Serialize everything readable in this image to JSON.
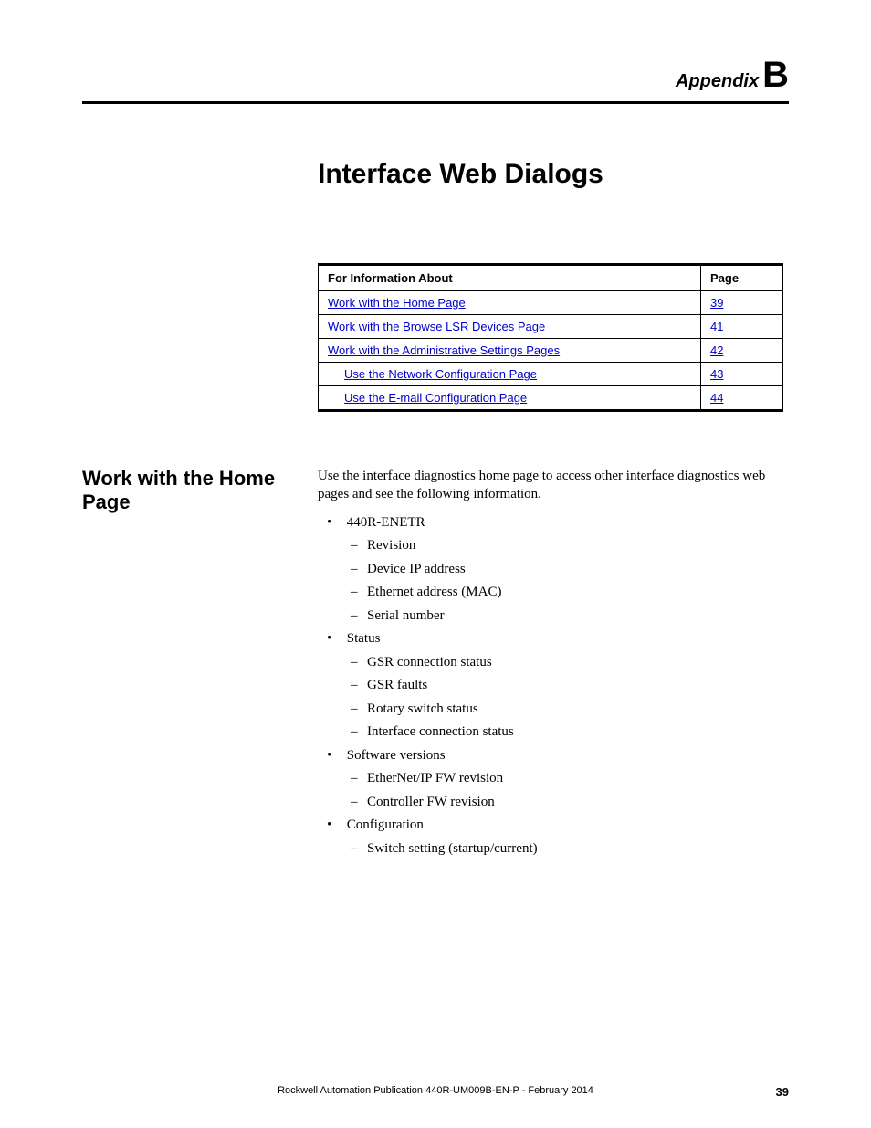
{
  "header": {
    "appendix_word": "Appendix",
    "appendix_letter": "B"
  },
  "chapter_title": "Interface Web Dialogs",
  "toc": {
    "col_info": "For Information About",
    "col_page": "Page",
    "rows": [
      {
        "label": "Work with the Home Page",
        "page": "39",
        "indent": 0
      },
      {
        "label": "Work with the Browse LSR Devices Page",
        "page": "41",
        "indent": 0
      },
      {
        "label": "Work with the Administrative Settings Pages",
        "page": "42",
        "indent": 0
      },
      {
        "label": "Use the Network Configuration Page",
        "page": "43",
        "indent": 1
      },
      {
        "label": "Use the E-mail Configuration Page",
        "page": "44",
        "indent": 1
      }
    ]
  },
  "section": {
    "heading": "Work with the Home Page",
    "intro": "Use the interface diagnostics home page to access other interface diagnostics web pages and see the following information.",
    "bullets": {
      "b0": "440R-ENETR",
      "b0_subs": {
        "s0": "Revision",
        "s1": "Device IP address",
        "s2": "Ethernet address (MAC)",
        "s3": "Serial number"
      },
      "b1": "Status",
      "b1_subs": {
        "s0": "GSR connection status",
        "s1": "GSR faults",
        "s2": "Rotary switch status",
        "s3": "Interface connection status"
      },
      "b2": "Software versions",
      "b2_subs": {
        "s0": "EtherNet/IP FW revision",
        "s1": "Controller FW revision"
      },
      "b3": "Configuration",
      "b3_subs": {
        "s0": "Switch setting (startup/current)"
      }
    }
  },
  "footer": {
    "publication": "Rockwell Automation Publication 440R-UM009B-EN-P - February 2014",
    "page_number": "39"
  }
}
